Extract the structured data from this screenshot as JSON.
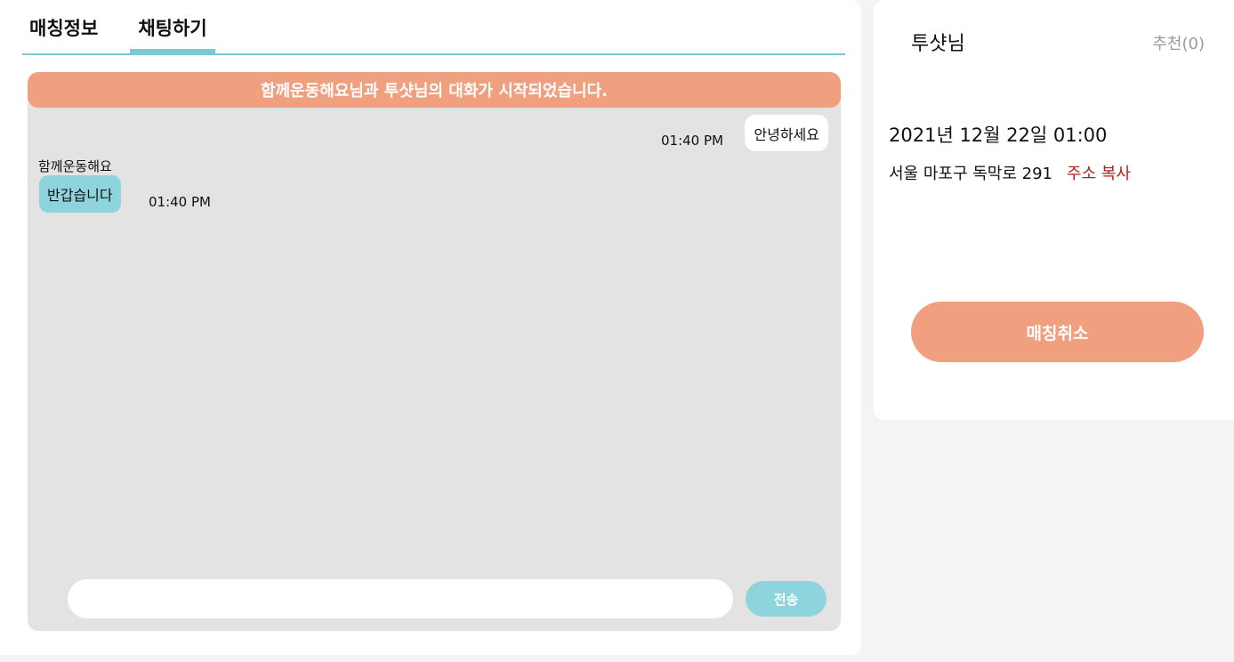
{
  "tabs": {
    "info_label": "매칭정보",
    "chat_label": "채팅하기"
  },
  "chat": {
    "banner": "함께운동해요님과 투샷님의 대화가 시작되었습니다.",
    "messages": [
      {
        "sender": "me",
        "text": "안녕하세요",
        "time": "01:40 PM"
      },
      {
        "sender": "함께운동해요",
        "text": "반갑습니다",
        "time": "01:40 PM"
      }
    ],
    "input_value": "",
    "send_label": "전송"
  },
  "side": {
    "partner_name": "투샷님",
    "recommend": "추천(0)",
    "datetime": "2021년 12월 22일 01:00",
    "address": "서울 마포구 독막로 291",
    "copy_label": "주소 복사",
    "cancel_label": "매칭취소"
  },
  "colors": {
    "accent_teal": "#7cc9d4",
    "bubble_teal": "#8dd4dd",
    "accent_orange": "#f09f7f",
    "copy_red": "#b31b1b"
  }
}
